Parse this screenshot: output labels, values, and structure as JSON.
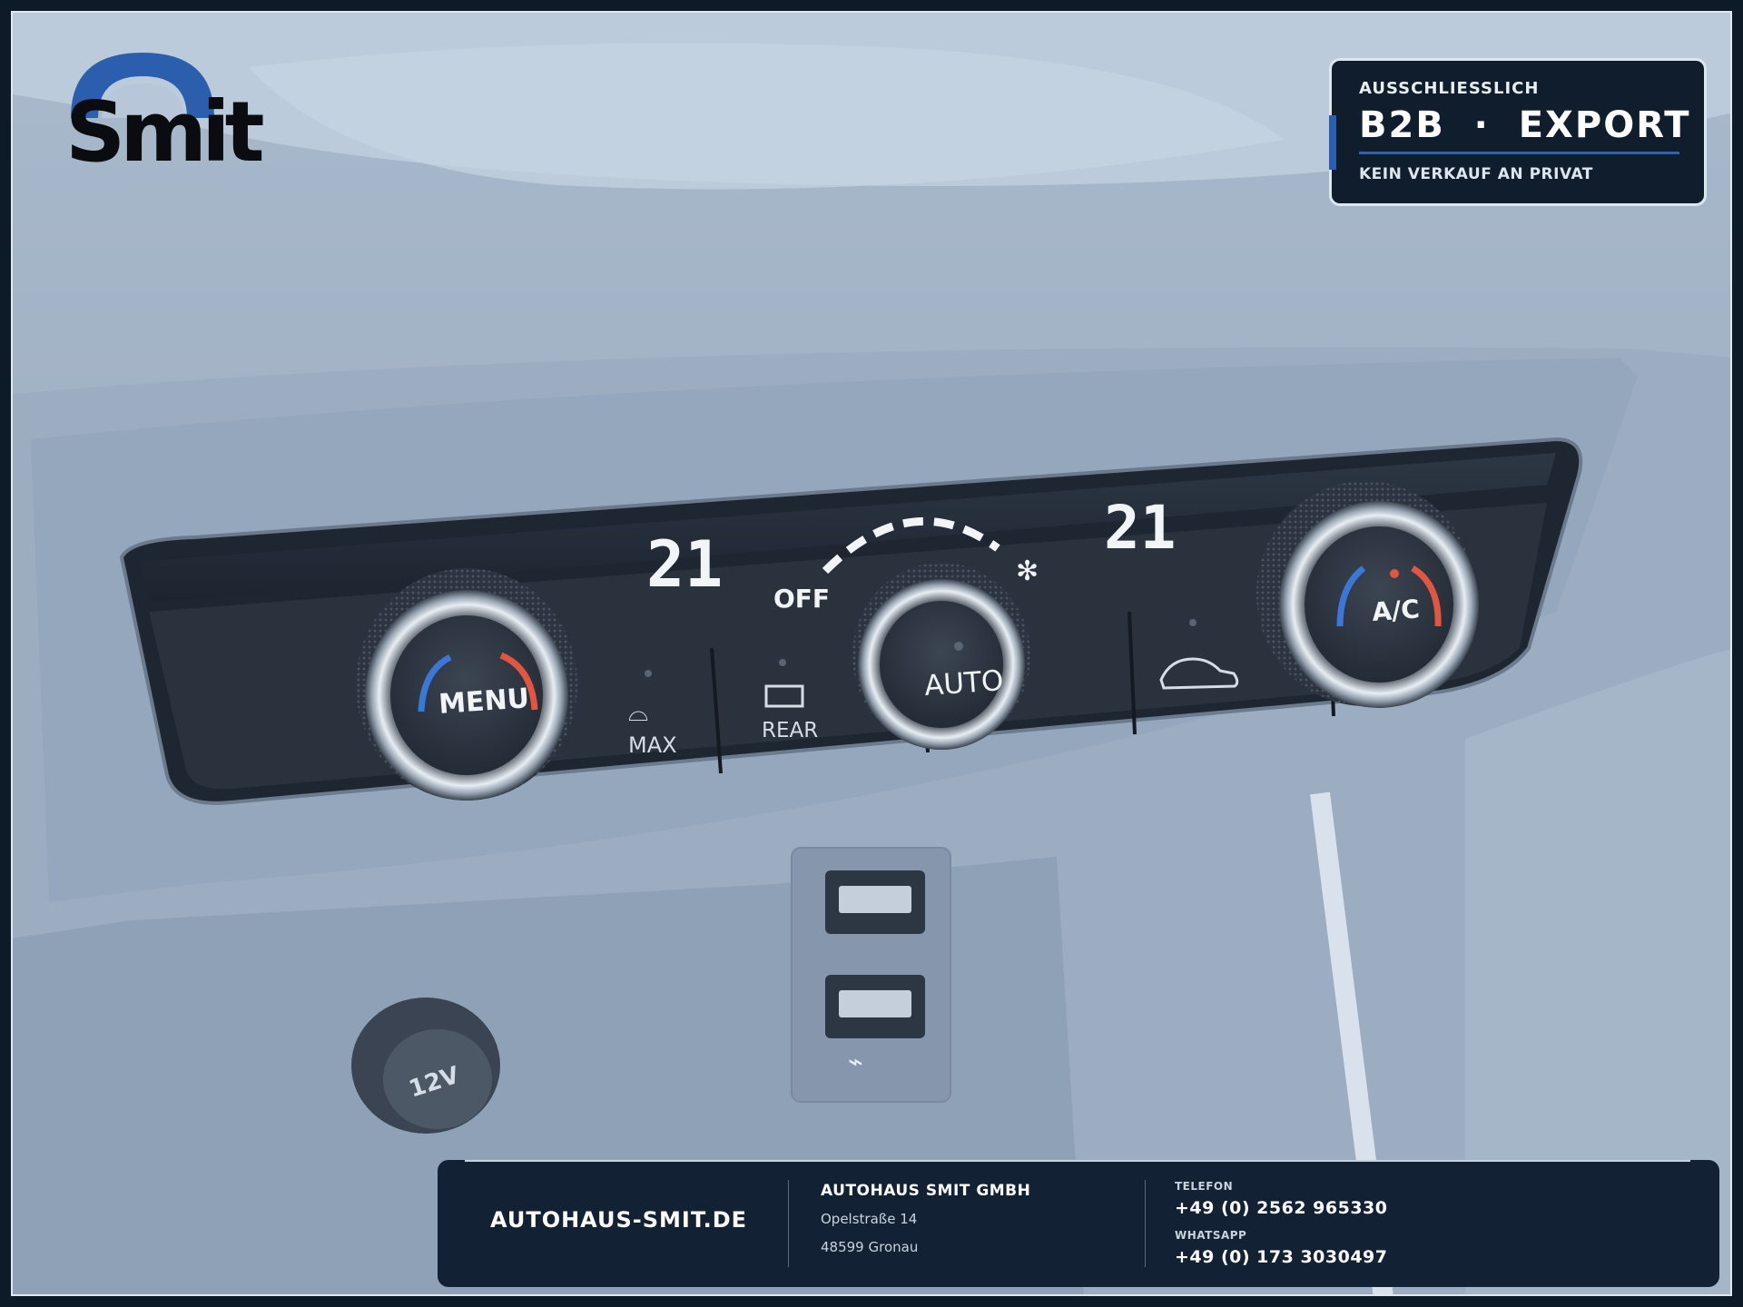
{
  "logo": {
    "text": "Smit",
    "arc_color": "#2b5fae"
  },
  "badge": {
    "top": "AUSSCHLIESSLICH",
    "main": "B2B  ·  EXPORT",
    "bottom": "KEIN VERKAUF AN PRIVAT",
    "accent": "#2b5fae"
  },
  "console": {
    "temp_left": "21",
    "temp_right": "21",
    "fan_off_label": "OFF",
    "menu_label": "MENU",
    "auto_label": "AUTO",
    "ac_label": "A/C",
    "max_label": "MAX",
    "rear_label": "REAR",
    "socket_label": "12V",
    "cold_color": "#3a78d8",
    "hot_color": "#e2553e"
  },
  "footer": {
    "website": "AUTOHAUS-SMIT.DE",
    "company": "AUTOHAUS SMIT GMBH",
    "street": "Opelstraße 14",
    "city": "48599 Gronau",
    "phone_label": "TELEFON",
    "phone": "+49 (0) 2562 965330",
    "whatsapp_label": "WHATSAPP",
    "whatsapp": "+49 (0) 173 3030497"
  }
}
